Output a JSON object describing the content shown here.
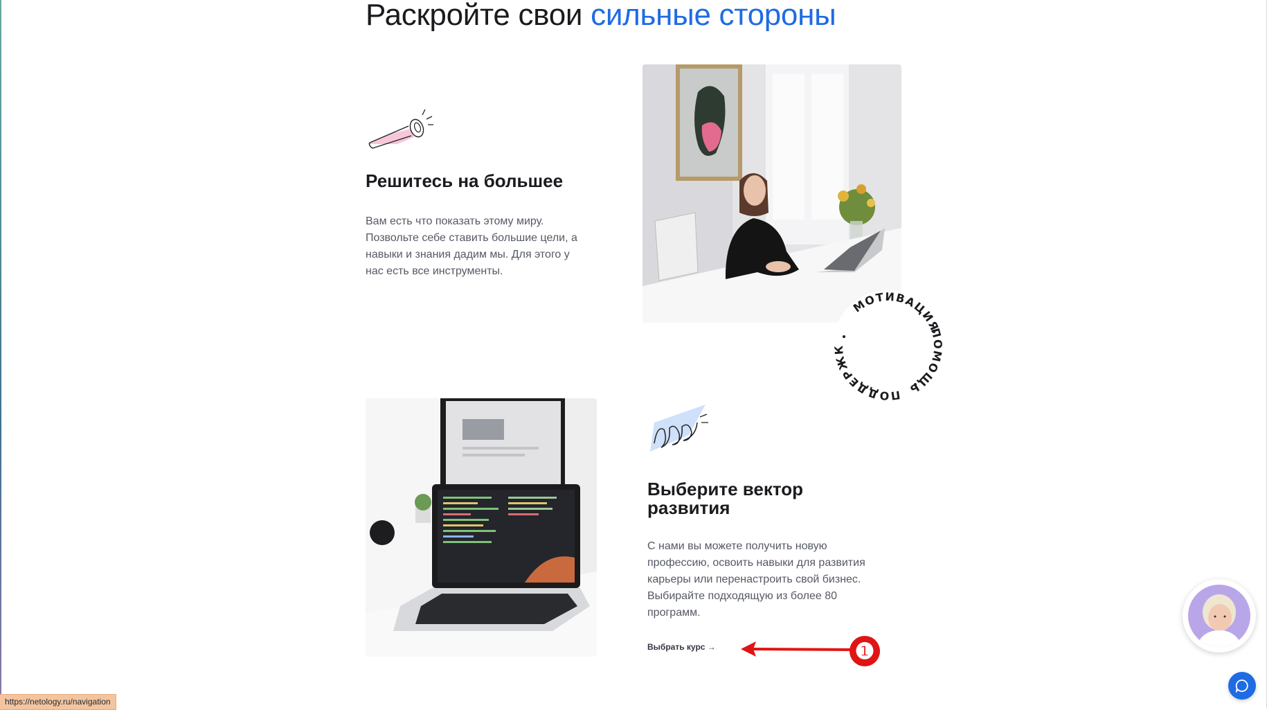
{
  "heading": {
    "text": "Раскройте свои ",
    "accent": "сильные стороны",
    "accent_color": "#1f6be3"
  },
  "cards": [
    {
      "icon": "telescope-icon",
      "title": "Решитесь на большее",
      "text": "Вам есть что показать этому миру. Позвольте себе ставить большие цели, а навыки и знания дадим мы. Для этого у нас есть все инструменты."
    },
    {
      "icon": "scribble-icon",
      "title": "Выберите вектор развития",
      "text": "С нами вы можете получить новую профессию, освоить навыки для развития карьеры или перенастроить свой бизнес. Выбирайте подходящую из более 80 программ.",
      "link": "Выбрать курс →"
    }
  ],
  "badge": {
    "words": [
      "МОТИВАЦИЯ",
      "ПОМОЩЬ",
      "ПОДДЕРЖКА"
    ]
  },
  "annotation": {
    "number": "❶",
    "color": "#e01414"
  },
  "status_bar": {
    "url": "https://netology.ru/navigation"
  },
  "widgets": {
    "avatar": "consultant-avatar",
    "chat": "chat-icon"
  }
}
